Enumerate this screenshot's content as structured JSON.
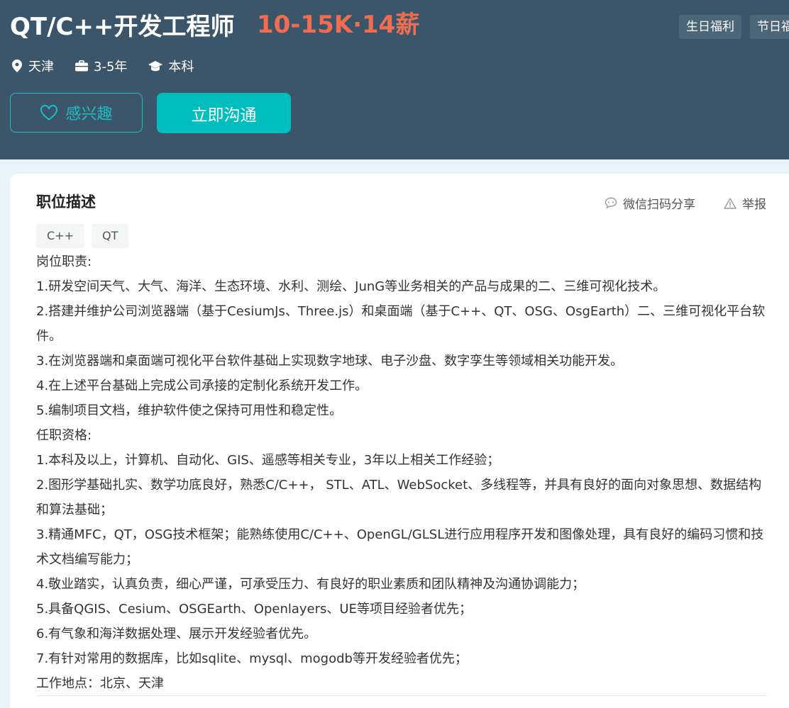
{
  "header": {
    "title": "QT/C++开发工程师",
    "salary": "10-15K·14薪",
    "welfare_tags": [
      "生日福利",
      "节日福"
    ],
    "meta": {
      "location": "天津",
      "experience": "3-5年",
      "education": "本科"
    },
    "buttons": {
      "interest": "感兴趣",
      "chat": "立即沟通"
    },
    "colors": {
      "header_bg": "#3b566b",
      "salary": "#f26d50",
      "accent": "#00bebd"
    }
  },
  "detail": {
    "section_title": "职位描述",
    "share_label": "微信扫码分享",
    "report_label": "举报",
    "skill_tags": [
      "C++",
      "QT"
    ],
    "lines": [
      "岗位职责:",
      "1.研发空间天气、大气、海洋、生态环境、水利、测绘、JunG等业务相关的产品与成果的二、三维可视化技术。",
      "2.搭建并维护公司浏览器端（基于CesiumJs、Three.js）和桌面端（基于C++、QT、OSG、OsgEarth）二、三维可视化平台软件。",
      "3.在浏览器端和桌面端可视化平台软件基础上实现数字地球、电子沙盘、数字孪生等领域相关功能开发。",
      "4.在上述平台基础上完成公司承接的定制化系统开发工作。",
      "5.编制项目文档，维护软件使之保持可用性和稳定性。",
      "任职资格:",
      "1.本科及以上，计算机、自动化、GIS、遥感等相关专业，3年以上相关工作经验；",
      "2.图形学基础扎实、数学功底良好，熟悉C/C++， STL、ATL、WebSocket、多线程等，并具有良好的面向对象思想、数据结构和算法基础；",
      "3.精通MFC，QT，OSG技术框架；能熟练使用C/C++、OpenGL/GLSL进行应用程序开发和图像处理，具有良好的编码习惯和技术文档编写能力；",
      "4.敬业踏实，认真负责，细心严谨，可承受压力、有良好的职业素质和团队精神及沟通协调能力；",
      "5.具备QGIS、Cesium、OSGEarth、Openlayers、UE等项目经验者优先；",
      "6.有气象和海洋数据处理、展示开发经验者优先。",
      "7.有针对常用的数据库，比如sqlite、mysql、mogodb等开发经验者优先；",
      "工作地点：北京、天津"
    ],
    "icons": {
      "share": "chat-bubble-icon",
      "report": "warning-triangle-icon"
    }
  }
}
